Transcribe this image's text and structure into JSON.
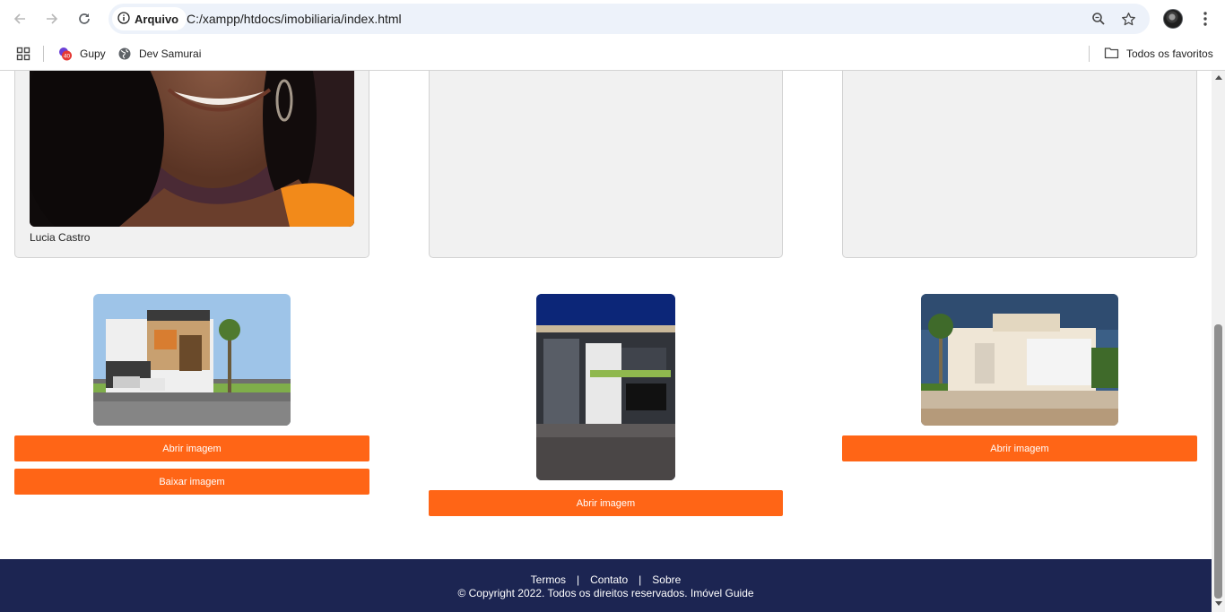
{
  "browser": {
    "security_chip": "Arquivo",
    "url": "C:/xampp/htdocs/imobiliaria/index.html",
    "bookmarks": [
      {
        "label": "Gupy",
        "badge": "40"
      },
      {
        "label": "Dev Samurai"
      }
    ],
    "all_bookmarks_label": "Todos os favoritos"
  },
  "cards": [
    {
      "name": "Lucia Castro"
    },
    {
      "name": ""
    },
    {
      "name": ""
    }
  ],
  "properties": [
    {
      "buttons": [
        "Abrir imagem",
        "Baixar imagem"
      ]
    },
    {
      "buttons": [
        "Abrir imagem"
      ]
    },
    {
      "buttons": [
        "Abrir imagem"
      ]
    }
  ],
  "footer": {
    "links": [
      "Termos",
      "Contato",
      "Sobre"
    ],
    "separator": "|",
    "copyright": "© Copyright 2022. Todos os direitos reservados. Imóvel Guide"
  },
  "colors": {
    "accent": "#ff6516",
    "footer_bg": "#1c2552"
  }
}
